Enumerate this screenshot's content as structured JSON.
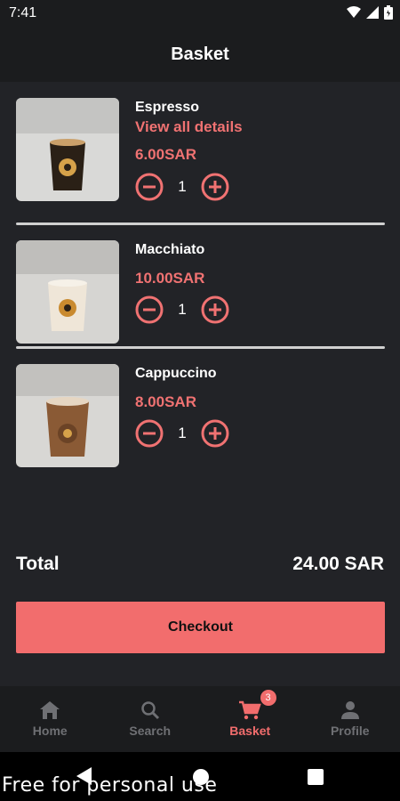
{
  "status": {
    "time": "7:41"
  },
  "header": {
    "title": "Basket"
  },
  "items": [
    {
      "name": "Espresso",
      "details_link": "View all details",
      "price": "6.00SAR",
      "quantity": "1",
      "cup_color": "#2a2016"
    },
    {
      "name": "Macchiato",
      "price": "10.00SAR",
      "quantity": "1",
      "cup_color": "#efe6d8"
    },
    {
      "name": "Cappuccino",
      "price": "8.00SAR",
      "quantity": "1",
      "cup_color": "#8a5a35"
    }
  ],
  "summary": {
    "total_label": "Total",
    "total_value": "24.00 SAR"
  },
  "checkout": {
    "label": "Checkout"
  },
  "nav": {
    "items": [
      {
        "label": "Home",
        "icon": "home-icon"
      },
      {
        "label": "Search",
        "icon": "search-icon"
      },
      {
        "label": "Basket",
        "icon": "cart-icon",
        "badge": "3",
        "active": true
      },
      {
        "label": "Profile",
        "icon": "person-icon"
      }
    ]
  },
  "watermark": "Free for personal use",
  "colors": {
    "accent": "#f26d6d",
    "background": "#222327",
    "bar": "#1b1c1e"
  }
}
